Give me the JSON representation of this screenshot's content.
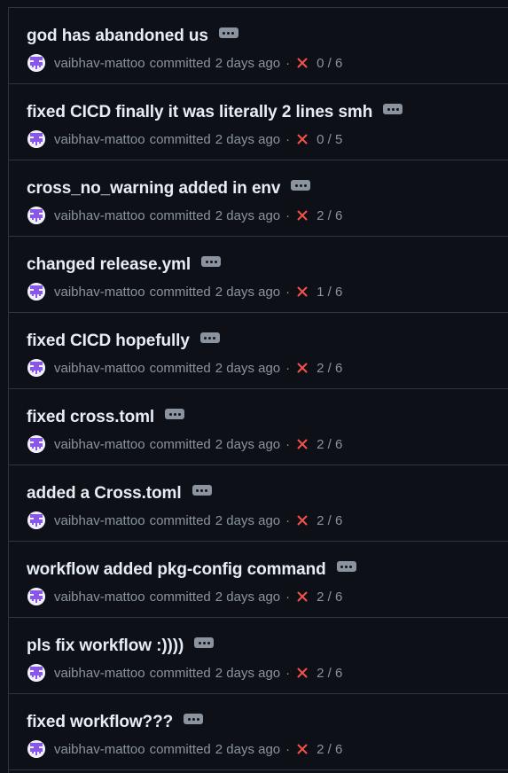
{
  "commits": [
    {
      "title": "god has abandoned us",
      "author": "vaibhav-mattoo",
      "verb": "committed",
      "time": "2 days ago",
      "checks": "0 / 6"
    },
    {
      "title": "fixed CICD finally it was literally 2 lines smh",
      "author": "vaibhav-mattoo",
      "verb": "committed",
      "time": "2 days ago",
      "checks": "0 / 5"
    },
    {
      "title": "cross_no_warning added in env",
      "author": "vaibhav-mattoo",
      "verb": "committed",
      "time": "2 days ago",
      "checks": "2 / 6"
    },
    {
      "title": "changed release.yml",
      "author": "vaibhav-mattoo",
      "verb": "committed",
      "time": "2 days ago",
      "checks": "1 / 6"
    },
    {
      "title": "fixed CICD hopefully",
      "author": "vaibhav-mattoo",
      "verb": "committed",
      "time": "2 days ago",
      "checks": "2 / 6"
    },
    {
      "title": "fixed cross.toml",
      "author": "vaibhav-mattoo",
      "verb": "committed",
      "time": "2 days ago",
      "checks": "2 / 6"
    },
    {
      "title": "added a Cross.toml",
      "author": "vaibhav-mattoo",
      "verb": "committed",
      "time": "2 days ago",
      "checks": "2 / 6"
    },
    {
      "title": "workflow added pkg-config command",
      "author": "vaibhav-mattoo",
      "verb": "committed",
      "time": "2 days ago",
      "checks": "2 / 6"
    },
    {
      "title": "pls fix workflow :))))",
      "author": "vaibhav-mattoo",
      "verb": "committed",
      "time": "2 days ago",
      "checks": "2 / 6"
    },
    {
      "title": "fixed workflow???",
      "author": "vaibhav-mattoo",
      "verb": "committed",
      "time": "2 days ago",
      "checks": "2 / 6"
    }
  ],
  "separator": "·",
  "status_icon": "x-icon",
  "colors": {
    "background": "#0d1117",
    "border": "#30363d",
    "text": "#e6edf3",
    "muted": "#8b949e",
    "fail": "#f85149",
    "avatar": "#8957e5"
  }
}
